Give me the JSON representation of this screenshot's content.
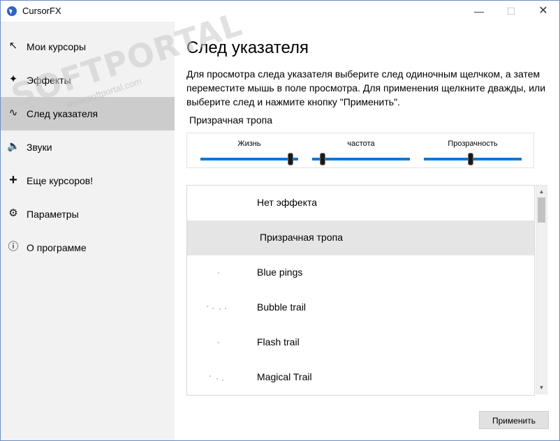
{
  "window": {
    "title": "CursorFX",
    "minimize_icon": "—",
    "maximize_icon": "☐",
    "close_icon": "✕"
  },
  "sidebar": {
    "items": [
      {
        "label": "Мои курсоры",
        "icon": "↖",
        "active": false
      },
      {
        "label": "Эффекты",
        "icon": "✦",
        "active": false
      },
      {
        "label": "След указателя",
        "icon": "∿",
        "active": true
      },
      {
        "label": "Звуки",
        "icon": "🔈",
        "active": false
      },
      {
        "label": "Еще курсоров!",
        "icon": "+",
        "active": false
      },
      {
        "label": "Параметры",
        "icon": "⚙",
        "active": false
      },
      {
        "label": "О программе",
        "icon": "ⓘ",
        "active": false
      }
    ]
  },
  "main": {
    "title": "След указателя",
    "description": "Для просмотра следа указателя выберите след одиночным щелчком, а затем переместите мышь в поле просмотра. Для применения щелкните дважды, или выберите след и нажмите кнопку \"Применить\".",
    "selected_trail": "Призрачная тропа",
    "sliders": [
      {
        "label": "Жизнь",
        "value": 0.95
      },
      {
        "label": "частота",
        "value": 0.08
      },
      {
        "label": "Прозрачность",
        "value": 0.48
      }
    ],
    "trails": [
      {
        "label": "Нет эффекта",
        "selected": false
      },
      {
        "label": "Призрачная тропа",
        "selected": true
      },
      {
        "label": "Blue pings",
        "selected": false
      },
      {
        "label": "Bubble trail",
        "selected": false
      },
      {
        "label": "Flash trail",
        "selected": false
      },
      {
        "label": "Magical Trail",
        "selected": false
      }
    ],
    "scroll_up": "▲",
    "scroll_down": "▼",
    "apply_label": "Применить"
  },
  "watermark": {
    "text": "SOFTPORTAL",
    "sub": "www.softportal.com"
  }
}
